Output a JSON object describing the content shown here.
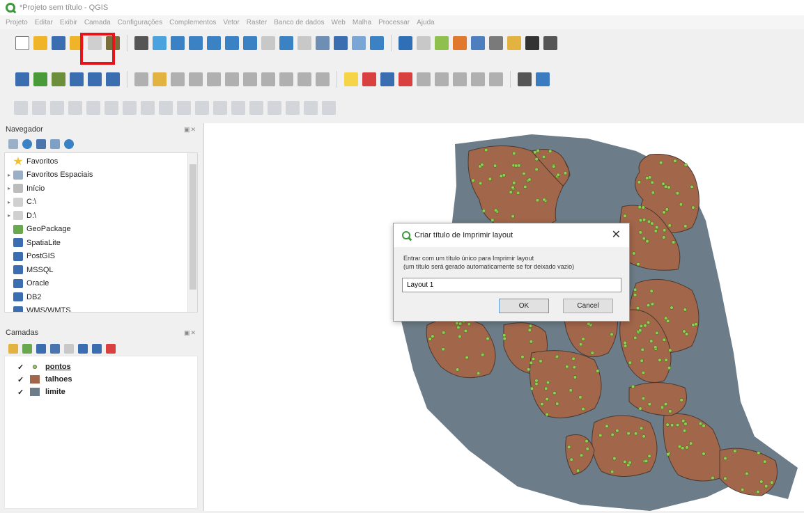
{
  "window": {
    "title": "*Projeto sem título - QGIS"
  },
  "menu": [
    "Projeto",
    "Editar",
    "Exibir",
    "Camada",
    "Configurações",
    "Complementos",
    "Vetor",
    "Raster",
    "Banco de dados",
    "Web",
    "Malha",
    "Processar",
    "Ajuda"
  ],
  "toolbar_main": [
    {
      "icon": "new-project-icon",
      "color": "#ffffff"
    },
    {
      "icon": "open-project-icon",
      "color": "#f0b429"
    },
    {
      "icon": "save-project-icon",
      "color": "#3b6db1"
    },
    {
      "icon": "new-print-layout-icon",
      "color": "#f0b429"
    },
    {
      "icon": "layout-manager-icon",
      "color": "#cfcfcf"
    },
    {
      "icon": "style-manager-icon",
      "color": "#7a6e3c"
    },
    {
      "icon": "pan-icon",
      "color": "#555555"
    },
    {
      "icon": "pan-to-selection-icon",
      "color": "#4aa3df"
    },
    {
      "icon": "zoom-in-icon",
      "color": "#3a82c4"
    },
    {
      "icon": "zoom-out-icon",
      "color": "#3a82c4"
    },
    {
      "icon": "zoom-full-icon",
      "color": "#3a82c4"
    },
    {
      "icon": "zoom-selection-icon",
      "color": "#3a82c4"
    },
    {
      "icon": "zoom-layer-icon",
      "color": "#3a82c4"
    },
    {
      "icon": "zoom-native-icon",
      "color": "#c8c8c8"
    },
    {
      "icon": "zoom-last-icon",
      "color": "#3a82c4"
    },
    {
      "icon": "zoom-next-icon",
      "color": "#c8c8c8"
    },
    {
      "icon": "new-bookmark-icon",
      "color": "#6e8fb3"
    },
    {
      "icon": "show-bookmarks-icon",
      "color": "#3b6db1"
    },
    {
      "icon": "temporal-controller-icon",
      "color": "#7aa6d6"
    },
    {
      "icon": "refresh-icon",
      "color": "#3a82c4"
    },
    {
      "icon": "identify-icon",
      "color": "#2f6fb5"
    },
    {
      "icon": "select-features-icon",
      "color": "#c8c8c8"
    },
    {
      "icon": "attribute-table-icon",
      "color": "#8fbf4d"
    },
    {
      "icon": "statistics-icon",
      "color": "#e0792d"
    },
    {
      "icon": "measure-icon",
      "color": "#4d7fbf"
    },
    {
      "icon": "map-tips-icon",
      "color": "#7a7a7a"
    },
    {
      "icon": "annotation-icon",
      "color": "#e3b341"
    },
    {
      "icon": "sum-icon",
      "color": "#333333"
    },
    {
      "icon": "more-icon",
      "color": "#555555"
    }
  ],
  "toolbar_layers": [
    {
      "icon": "data-source-manager-icon",
      "color": "#3b6db1"
    },
    {
      "icon": "add-vector-icon",
      "color": "#4a9a3a"
    },
    {
      "icon": "add-raster-icon",
      "color": "#6b8f3a"
    },
    {
      "icon": "digitize-icon",
      "color": "#3b6db1"
    },
    {
      "icon": "add-wms-icon",
      "color": "#3b6db1"
    },
    {
      "icon": "add-delimited-icon",
      "color": "#3b6db1"
    },
    {
      "icon": "edit-pencil-icon",
      "color": "#b0b0b0"
    },
    {
      "icon": "toggle-editing-icon",
      "color": "#e3b341"
    },
    {
      "icon": "save-edits-icon",
      "color": "#b0b0b0"
    },
    {
      "icon": "add-feature-icon",
      "color": "#b0b0b0"
    },
    {
      "icon": "vertex-tool-icon",
      "color": "#b0b0b0"
    },
    {
      "icon": "delete-feature-icon",
      "color": "#b0b0b0"
    },
    {
      "icon": "cut-icon",
      "color": "#b0b0b0"
    },
    {
      "icon": "copy-icon",
      "color": "#b0b0b0"
    },
    {
      "icon": "paste-icon",
      "color": "#b0b0b0"
    },
    {
      "icon": "undo-icon",
      "color": "#b0b0b0"
    },
    {
      "icon": "redo-icon",
      "color": "#b0b0b0"
    },
    {
      "icon": "label-icon",
      "color": "#f5d547"
    },
    {
      "icon": "diagram-icon",
      "color": "#d94040"
    },
    {
      "icon": "pin-labels-icon",
      "color": "#3b6db1"
    },
    {
      "icon": "highlight-labels-icon",
      "color": "#d94040"
    },
    {
      "icon": "label-tool-1-icon",
      "color": "#b0b0b0"
    },
    {
      "icon": "label-tool-2-icon",
      "color": "#b0b0b0"
    },
    {
      "icon": "label-tool-3-icon",
      "color": "#b0b0b0"
    },
    {
      "icon": "label-tool-4-icon",
      "color": "#b0b0b0"
    },
    {
      "icon": "label-tool-5-icon",
      "color": "#b0b0b0"
    },
    {
      "icon": "plugin-globe-icon",
      "color": "#555555"
    },
    {
      "icon": "python-icon",
      "color": "#3b7bbf"
    }
  ],
  "toolbar_digitize": [
    {
      "icon": "digitize-1-icon"
    },
    {
      "icon": "digitize-2-icon"
    },
    {
      "icon": "digitize-3-icon"
    },
    {
      "icon": "digitize-4-icon"
    },
    {
      "icon": "digitize-5-icon"
    },
    {
      "icon": "digitize-6-icon"
    },
    {
      "icon": "digitize-7-icon"
    },
    {
      "icon": "digitize-8-icon"
    },
    {
      "icon": "digitize-9-icon"
    },
    {
      "icon": "digitize-10-icon"
    },
    {
      "icon": "digitize-11-icon"
    },
    {
      "icon": "digitize-12-icon"
    },
    {
      "icon": "digitize-13-icon"
    },
    {
      "icon": "digitize-14-icon"
    },
    {
      "icon": "digitize-15-icon"
    },
    {
      "icon": "digitize-16-icon"
    },
    {
      "icon": "digitize-17-icon"
    },
    {
      "icon": "digitize-18-icon"
    }
  ],
  "browser": {
    "title": "Navegador",
    "items": [
      {
        "label": "Favoritos",
        "icon": "star-icon",
        "color": "#f2c12e",
        "arrow": ""
      },
      {
        "label": "Favoritos Espaciais",
        "icon": "spatial-bookmark-icon",
        "color": "#9ab0c8",
        "arrow": "▸"
      },
      {
        "label": "Início",
        "icon": "home-folder-icon",
        "color": "#bcbcbc",
        "arrow": "▸"
      },
      {
        "label": "C:\\",
        "icon": "drive-icon",
        "color": "#d0d0d0",
        "arrow": "▸"
      },
      {
        "label": "D:\\",
        "icon": "drive-icon",
        "color": "#d0d0d0",
        "arrow": "▸"
      },
      {
        "label": "GeoPackage",
        "icon": "geopackage-icon",
        "color": "#6aa84f",
        "arrow": ""
      },
      {
        "label": "SpatiaLite",
        "icon": "spatialite-icon",
        "color": "#3b6db1",
        "arrow": ""
      },
      {
        "label": "PostGIS",
        "icon": "postgis-icon",
        "color": "#3b6db1",
        "arrow": ""
      },
      {
        "label": "MSSQL",
        "icon": "mssql-icon",
        "color": "#3b6db1",
        "arrow": ""
      },
      {
        "label": "Oracle",
        "icon": "oracle-icon",
        "color": "#3b6db1",
        "arrow": ""
      },
      {
        "label": "DB2",
        "icon": "db2-icon",
        "color": "#3b6db1",
        "arrow": ""
      },
      {
        "label": "WMS/WMTS",
        "icon": "wms-icon",
        "color": "#3b6db1",
        "arrow": ""
      }
    ]
  },
  "layers_panel": {
    "title": "Camadas",
    "layers": [
      {
        "name": "pontos",
        "swatch": "#8fd14f",
        "type": "point",
        "checked": true
      },
      {
        "name": "talhoes",
        "swatch": "#a2664a",
        "type": "polygon",
        "checked": true
      },
      {
        "name": "limite",
        "swatch": "#6c7c88",
        "type": "polygon",
        "checked": true
      }
    ]
  },
  "dialog": {
    "title": "Criar título de Imprimir layout",
    "message_line1": "Entrar com um título único para Imprimir layout",
    "message_line2": "(um título será gerado automaticamente se for deixado vazio)",
    "input_value": "Layout 1",
    "ok_label": "OK",
    "cancel_label": "Cancel"
  },
  "map": {
    "boundary_color": "#6c7c88",
    "field_color": "#a2664a",
    "point_color": "#8fd14f"
  }
}
